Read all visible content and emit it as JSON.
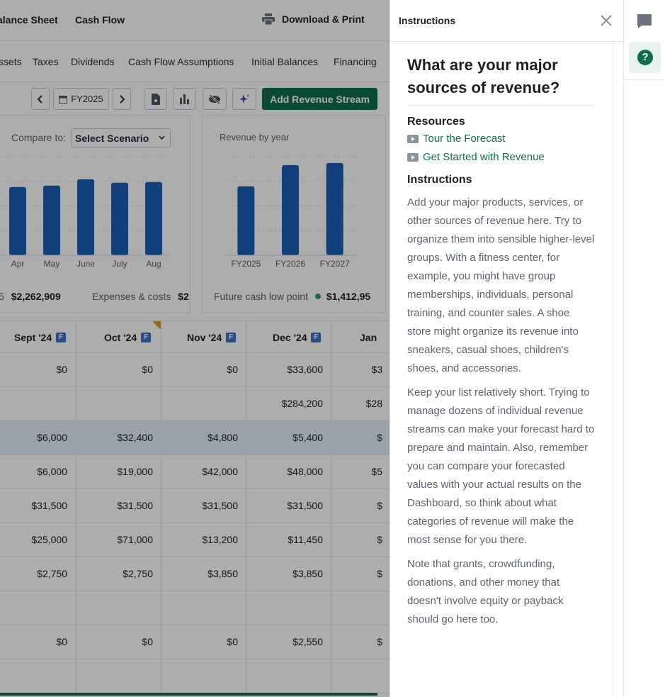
{
  "topbar": {
    "tabs": [
      "alance Sheet",
      "Cash Flow"
    ],
    "print_label": "Download & Print"
  },
  "subnav": [
    "ssets",
    "Taxes",
    "Dividends",
    "Cash Flow Assumptions",
    "Initial Balances",
    "Financing"
  ],
  "toolbar": {
    "year": "FY2025",
    "add_label": "Add Revenue Stream"
  },
  "compare": {
    "label": "Compare to:",
    "value": "Select Scenario"
  },
  "monthly_chart": {
    "chart_data": {
      "type": "bar",
      "categories": [
        "Apr",
        "May",
        "June",
        "July",
        "Aug"
      ],
      "values": [
        97,
        99,
        108,
        103,
        104
      ],
      "ylim": [
        0,
        140
      ]
    }
  },
  "yearly_chart": {
    "title": "Revenue by year",
    "chart_data": {
      "type": "bar",
      "categories": [
        "FY2025",
        "FY2026",
        "FY2027"
      ],
      "values": [
        98,
        128,
        131
      ],
      "ylim": [
        0,
        140
      ]
    }
  },
  "kpis": [
    {
      "label": "5",
      "value": "$2,262,909"
    },
    {
      "label": "Expenses & costs",
      "value": "$2"
    },
    {
      "label": "Future cash low point",
      "value": "$1,412,95"
    }
  ],
  "table": {
    "columns": [
      "Sept '24",
      "Oct '24",
      "Nov '24",
      "Dec '24",
      "Jan"
    ],
    "col_badge": "F",
    "rows": [
      [
        "$0",
        "$0",
        "$0",
        "$33,600",
        "$3"
      ],
      [
        "",
        "",
        "",
        "$284,200",
        "$28"
      ],
      [
        "$6,000",
        "$32,400",
        "$4,800",
        "$5,400",
        "$"
      ],
      [
        "$6,000",
        "$19,000",
        "$42,000",
        "$48,000",
        "$5"
      ],
      [
        "$31,500",
        "$31,500",
        "$31,500",
        "$31,500",
        "$"
      ],
      [
        "$25,000",
        "$71,000",
        "$13,200",
        "$11,450",
        "$"
      ],
      [
        "$2,750",
        "$2,750",
        "$3,850",
        "$3,850",
        "$"
      ],
      [
        "",
        "",
        "",
        "",
        ""
      ],
      [
        "$0",
        "$0",
        "$0",
        "$2,550",
        "$"
      ],
      [
        "",
        "",
        "",
        "",
        ""
      ]
    ]
  },
  "panel": {
    "title": "Instructions",
    "question": "What are your major sources of revenue?",
    "resources_heading": "Resources",
    "links": [
      "Tour the Forecast",
      "Get Started with Revenue"
    ],
    "instructions_heading": "Instructions",
    "paragraphs": [
      "Add your major products, services, or other sources of revenue here. Try to organize them into sensible higher-level groups. With a fitness center, for example, you might have group memberships, individuals, personal training, and counter sales. A shoe store might organize its revenue into sneakers, casual shoes, children's shoes, and accessories.",
      "Keep your list relatively short. Trying to manage dozens of individual revenue streams can make your forecast hard to prepare and maintain. Also, remember you can compare your forecasted values with your actual results on the Dashboard, so think about what categories of revenue will make the most sense for you there.",
      "Note that grants, crowdfunding, donations, and other money that doesn't involve equity or payback should go here too."
    ]
  },
  "rail": {
    "help_glyph": "?"
  },
  "colors": {
    "accent": "#0f6e4d",
    "bar": "#1a5fb4",
    "badge": "#3a74c9"
  }
}
